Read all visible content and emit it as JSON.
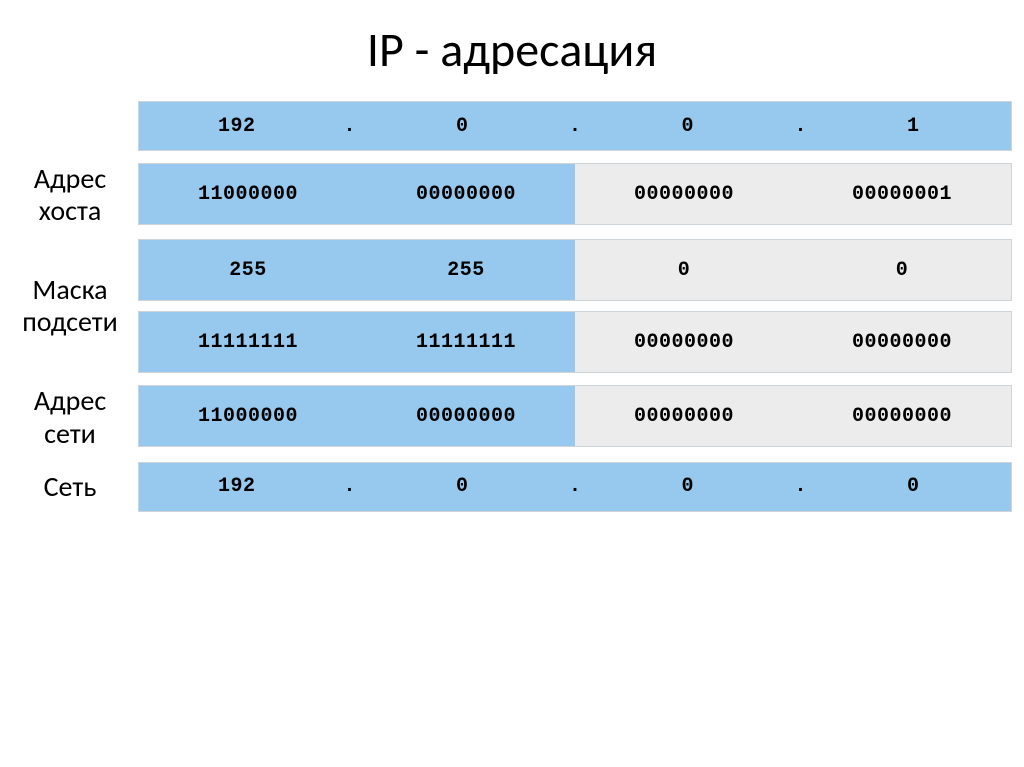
{
  "title": "IP - адресация",
  "labels": {
    "host": [
      "Адрес",
      "хоста"
    ],
    "mask": [
      "Маска",
      "подсети"
    ],
    "net": [
      "Адрес",
      "сети"
    ],
    "network": "Сеть"
  },
  "ip_decimal": {
    "o1": "192",
    "o2": "0",
    "o3": "0",
    "o4": "1",
    "dot": "."
  },
  "host_binary": {
    "o1": "11000000",
    "o2": "00000000",
    "o3": "00000000",
    "o4": "00000001"
  },
  "mask_decimal": {
    "o1": "255",
    "o2": "255",
    "o3": "0",
    "o4": "0"
  },
  "mask_binary": {
    "o1": "11111111",
    "o2": "11111111",
    "o3": "00000000",
    "o4": "00000000"
  },
  "net_binary": {
    "o1": "11000000",
    "o2": "00000000",
    "o3": "00000000",
    "o4": "00000000"
  },
  "net_decimal": {
    "o1": "192",
    "o2": "0",
    "o3": "0",
    "o4": "0",
    "dot": "."
  }
}
